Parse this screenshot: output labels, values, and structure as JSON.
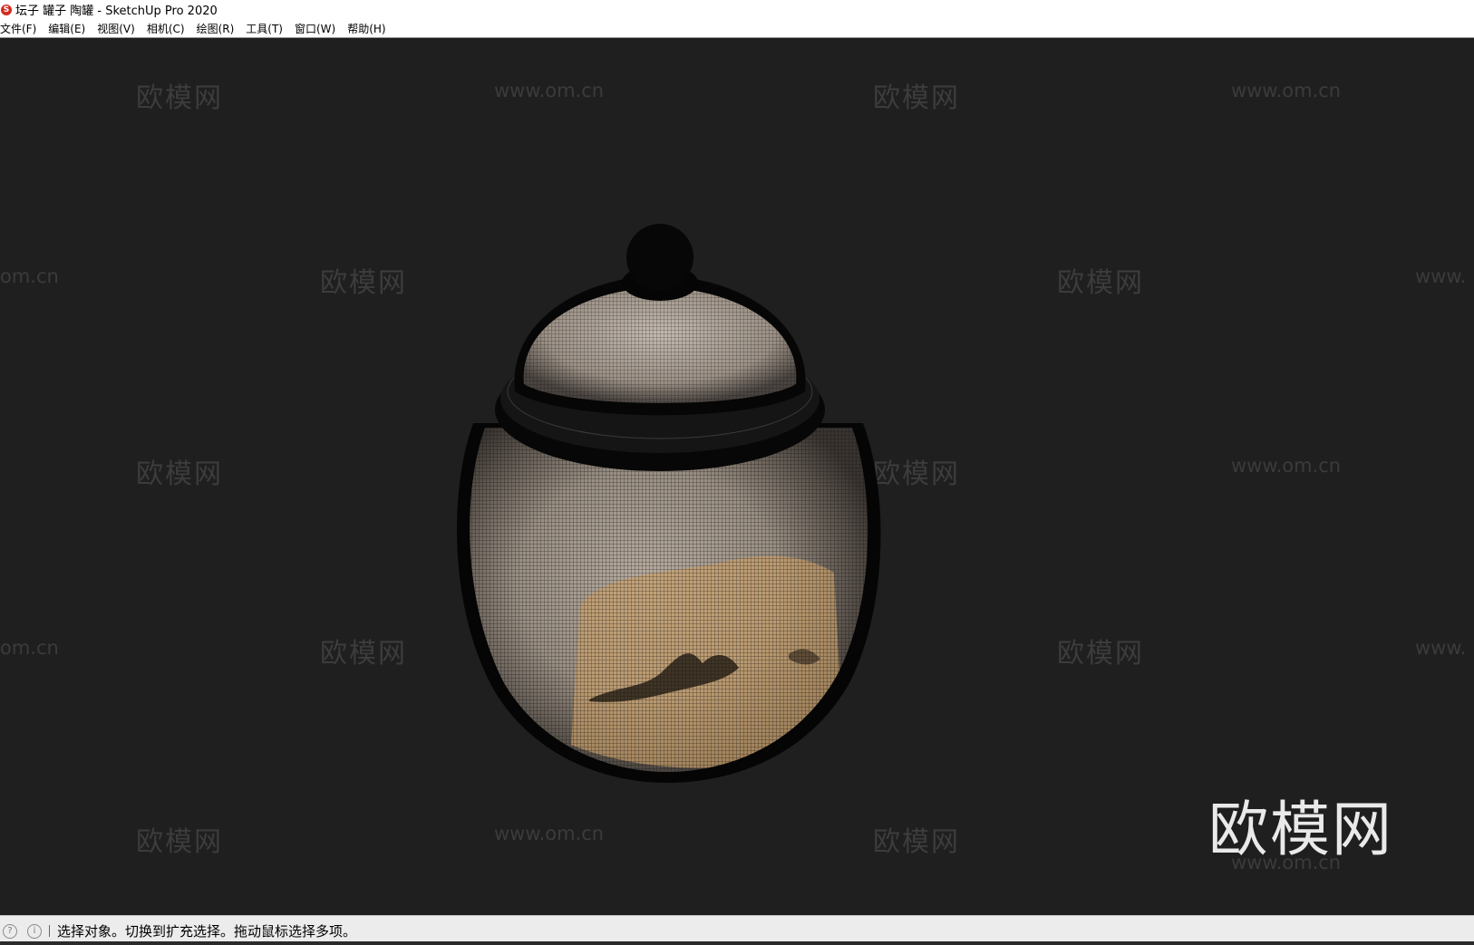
{
  "window": {
    "title": "坛子 罐子 陶罐 - SketchUp Pro 2020",
    "app_icon_glyph": "S"
  },
  "menu": {
    "items": [
      {
        "label": "文件(F)"
      },
      {
        "label": "编辑(E)"
      },
      {
        "label": "视图(V)"
      },
      {
        "label": "相机(C)"
      },
      {
        "label": "绘图(R)"
      },
      {
        "label": "工具(T)"
      },
      {
        "label": "窗口(W)"
      },
      {
        "label": "帮助(H)"
      }
    ]
  },
  "viewport": {
    "background_color": "#1f1f1f",
    "watermark_cn": "欧模网",
    "watermark_url": "www.om.cn",
    "watermark_url_partial_left": "om.cn",
    "watermark_url_partial_right": "www.",
    "big_watermark": "欧模网",
    "model_name": "ceramic-jar-wireframe"
  },
  "status": {
    "icon_1": "?",
    "icon_2": "i",
    "message": "选择对象。切换到扩充选择。拖动鼠标选择多项。"
  }
}
